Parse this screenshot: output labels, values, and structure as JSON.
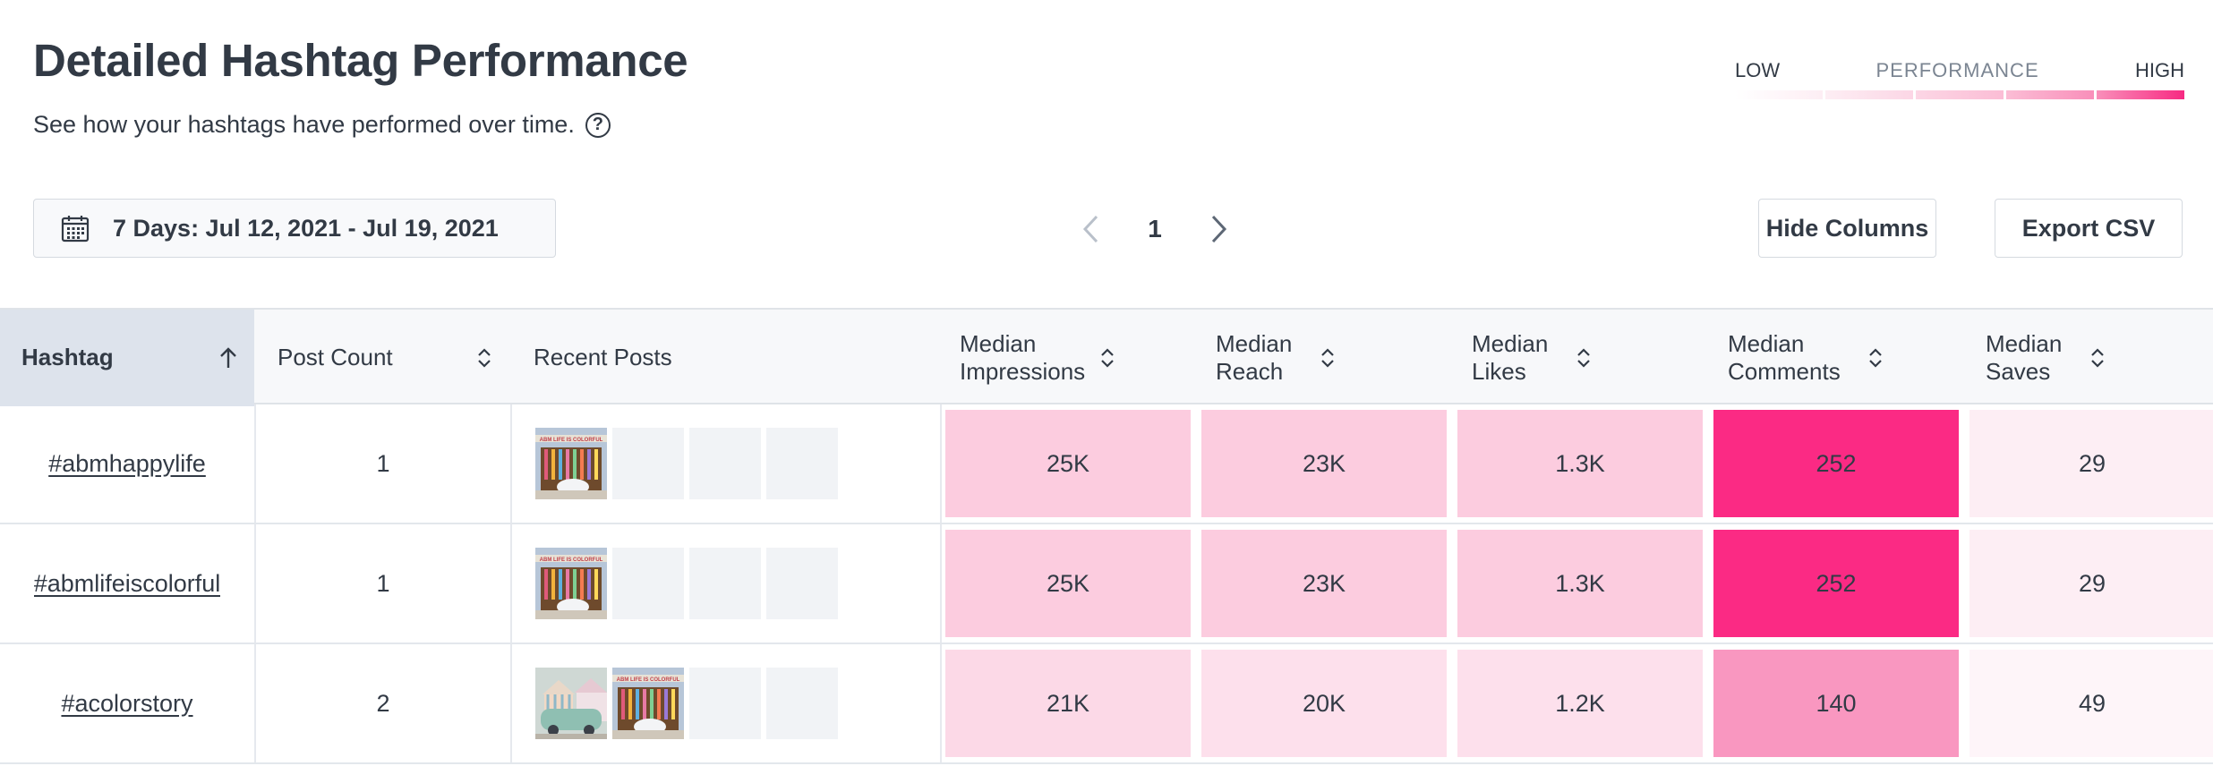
{
  "header": {
    "title": "Detailed Hashtag Performance",
    "subtitle": "See how your hashtags have performed over time.",
    "help_icon": "?"
  },
  "legend": {
    "low": "LOW",
    "mid": "PERFORMANCE",
    "high": "HIGH",
    "colors": [
      "#fdeef4",
      "#fcd6e5",
      "#fbbdd5",
      "#f98fba",
      "#f72a82"
    ]
  },
  "toolbar": {
    "date_range": "7 Days: Jul 12, 2021 - Jul 19, 2021",
    "page": "1",
    "hide_columns": "Hide Columns",
    "export_csv": "Export CSV"
  },
  "table": {
    "columns": {
      "hashtag": "Hashtag",
      "post_count": "Post Count",
      "recent_posts": "Recent Posts",
      "median_impressions": "Median Impressions",
      "median_reach": "Median Reach",
      "median_likes": "Median Likes",
      "median_comments": "Median Comments",
      "median_saves": "Median Saves"
    },
    "rows": [
      {
        "hashtag": "#abmhappylife",
        "post_count": "1",
        "recent_posts": [
          "storefront",
          "",
          "",
          ""
        ],
        "impressions": "25K",
        "reach": "23K",
        "likes": "1.3K",
        "comments": "252",
        "saves": "29",
        "heat": [
          "#fcccdf",
          "#fcccdf",
          "#fcccdf",
          "#fb2a84",
          "#fdeef4"
        ]
      },
      {
        "hashtag": "#abmlifeiscolorful",
        "post_count": "1",
        "recent_posts": [
          "storefront",
          "",
          "",
          ""
        ],
        "impressions": "25K",
        "reach": "23K",
        "likes": "1.3K",
        "comments": "252",
        "saves": "29",
        "heat": [
          "#fcccdf",
          "#fcccdf",
          "#fcccdf",
          "#fb2a84",
          "#fdeef4"
        ]
      },
      {
        "hashtag": "#acolorstory",
        "post_count": "2",
        "recent_posts": [
          "beach-hut",
          "storefront",
          "",
          ""
        ],
        "impressions": "21K",
        "reach": "20K",
        "likes": "1.2K",
        "comments": "140",
        "saves": "49",
        "heat": [
          "#fcd9e7",
          "#fde0ec",
          "#fde0ec",
          "#f997c0",
          "#fef5f9"
        ]
      }
    ]
  }
}
